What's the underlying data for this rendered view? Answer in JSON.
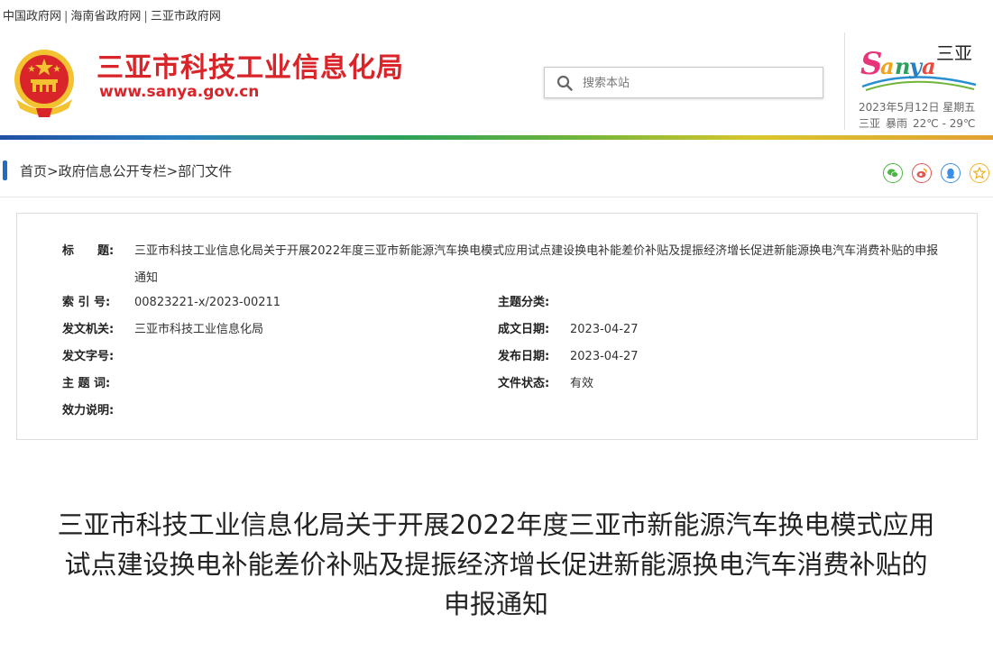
{
  "topbar": {
    "links": [
      "中国政府网",
      "海南省政府网",
      "三亚市政府网"
    ],
    "separator": "|"
  },
  "header": {
    "site_name": "三亚市科技工业信息化局",
    "site_url": "www.sanya.gov.cn",
    "search_placeholder": "搜索本站",
    "date": "2023年5月12日 星期五",
    "city": "三亚",
    "weather": "暴雨",
    "temperature": "22℃ - 29℃",
    "logo_text": "Sanya",
    "logo_chinese": "三亚"
  },
  "breadcrumb": {
    "text": "首页>政府信息公开专栏>部门文件"
  },
  "share_icons": [
    "wechat-icon",
    "weibo-icon",
    "qq-icon",
    "favorite-icon"
  ],
  "info": {
    "title_label": "标　　题:",
    "title_value": "三亚市科技工业信息化局关于开展2022年度三亚市新能源汽车换电模式应用试点建设换电补能差价补贴及提振经济增长促进新能源换电汽车消费补贴的申报通知",
    "index_label": "索 引 号:",
    "index_value": "00823221-x/2023-00211",
    "category_label": "主题分类:",
    "category_value": "",
    "issuer_label": "发文机关:",
    "issuer_value": "三亚市科技工业信息化局",
    "created_label": "成文日期:",
    "created_value": "2023-04-27",
    "docno_label": "发文字号:",
    "docno_value": "",
    "published_label": "发布日期:",
    "published_value": "2023-04-27",
    "keywords_label": "主 题 词:",
    "keywords_value": "",
    "status_label": "文件状态:",
    "status_value": "有效",
    "validity_label": "效力说明:",
    "validity_value": ""
  },
  "article": {
    "title": "三亚市科技工业信息化局关于开展2022年度三亚市新能源汽车换电模式应用试点建设换电补能差价补贴及提振经济增长促进新能源换电汽车消费补贴的申报通知"
  },
  "colors": {
    "brand_red": "#d9252a",
    "breadcrumb_mark": "#1f6fc1"
  }
}
